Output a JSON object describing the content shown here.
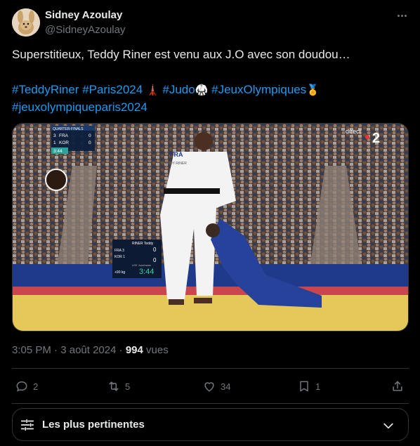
{
  "author": {
    "name": "Sidney Azoulay",
    "handle": "@SidneyAzoulay"
  },
  "post": {
    "text": "Superstitieux, Teddy Riner est venu aux J.O avec son doudou…",
    "hashtags": [
      "#TeddyRiner",
      "#Paris2024",
      "#Judo",
      "#JeuxOlympiques",
      "#jeuxolympiqueparis2024"
    ],
    "emojis": [
      "🗼",
      "🥋",
      "🏅"
    ]
  },
  "media": {
    "broadcast_logo": "direct",
    "channel_number": "2",
    "score_top": {
      "stage": "QUARTER-FINALS",
      "rows": [
        {
          "seed": "3",
          "country": "FRA",
          "score": "0"
        },
        {
          "seed": "1",
          "country": "KOR",
          "score": "0"
        }
      ],
      "clock": "3:44"
    },
    "scoreboard": {
      "name": "RINER Teddy",
      "row1": "FRA  3",
      "row2": "KOR  1",
      "sub": "LEE Joonhwan",
      "category": "+90 kg",
      "score_a": "0",
      "score_b": "0",
      "clock": "3:44"
    },
    "jersey_text": "FRA",
    "jersey_name": "TEDDY RINER"
  },
  "meta": {
    "time": "3:05 PM",
    "separator": "·",
    "date": "3 août 2024",
    "views": "994",
    "views_label": "vues"
  },
  "actions": {
    "replies": "2",
    "reposts": "5",
    "likes": "34",
    "bookmarks": "1"
  },
  "sort": {
    "label": "Les plus pertinentes"
  },
  "colors": {
    "background": "#000000",
    "text": "#e7e9ea",
    "muted": "#71767b",
    "link": "#1d9bf0",
    "border": "#2f3336"
  }
}
